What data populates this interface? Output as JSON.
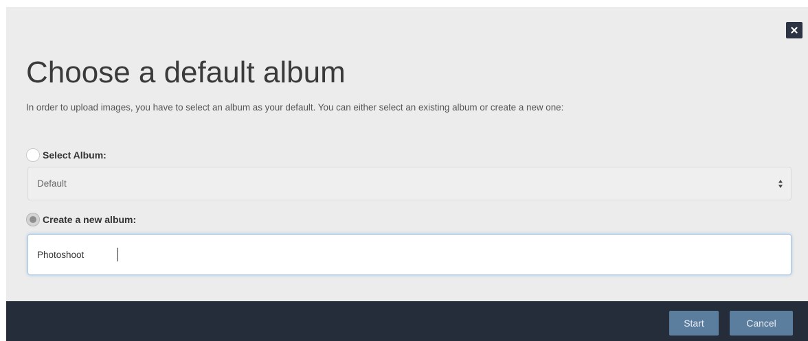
{
  "dialog": {
    "title": "Choose a default album",
    "description": "In order to upload images, you have to select an album as your default. You can either select an existing album or create a new one:",
    "close_icon": "close-icon"
  },
  "select_album": {
    "label": "Select Album:",
    "checked": false,
    "value": "Default"
  },
  "create_album": {
    "label": "Create a new album:",
    "checked": true,
    "value": "Photoshoot"
  },
  "footer": {
    "start_label": "Start",
    "cancel_label": "Cancel"
  },
  "colors": {
    "dialog_bg": "#ececec",
    "footer_bg": "#252d3b",
    "button_bg": "#5b7d9e",
    "close_bg": "#2c3443"
  }
}
